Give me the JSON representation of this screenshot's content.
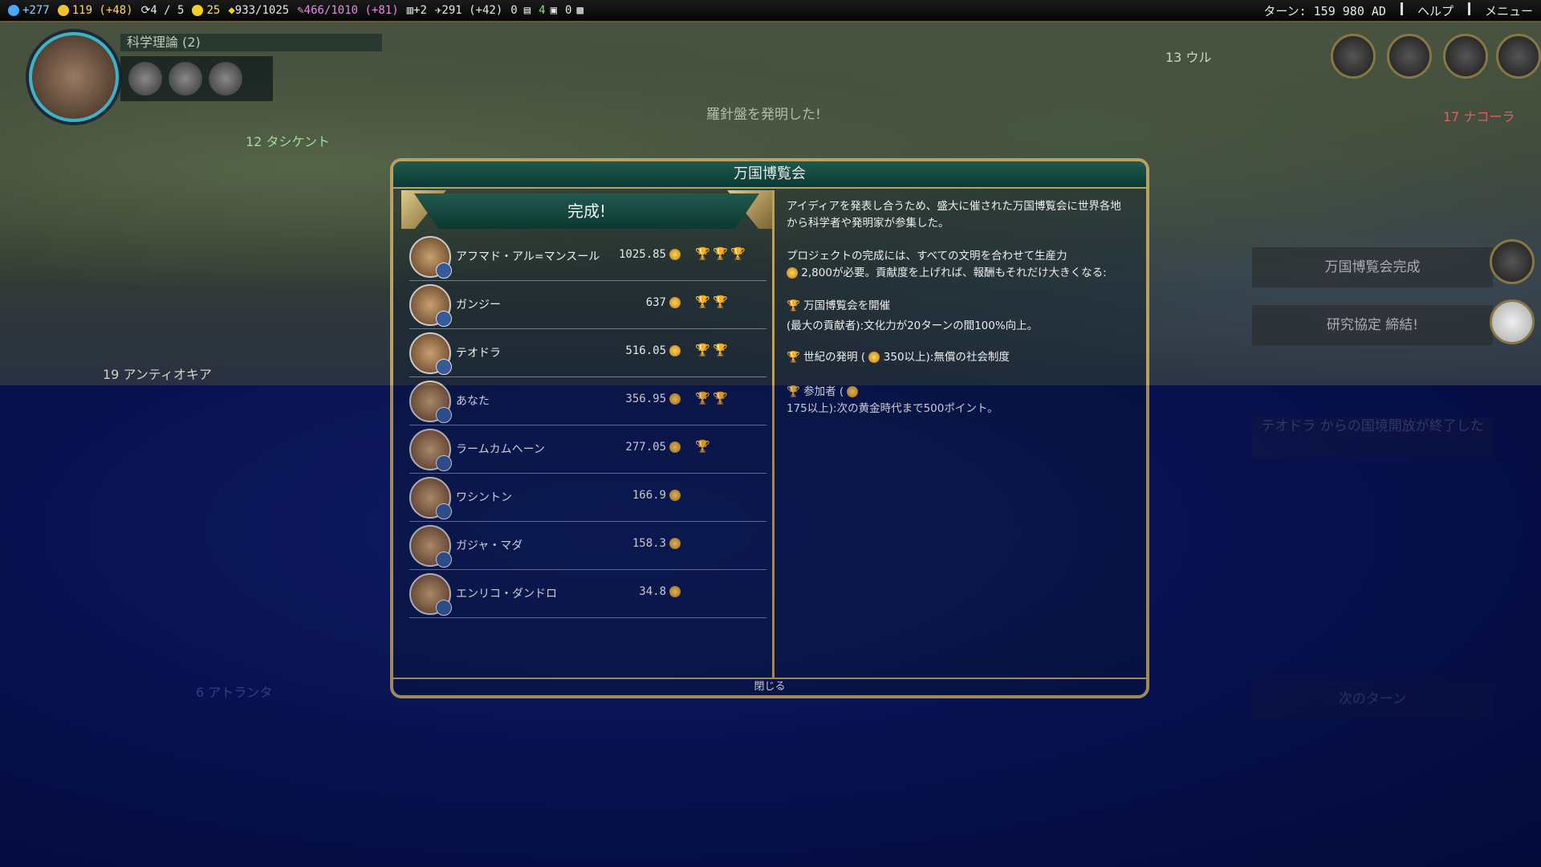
{
  "topbar": {
    "science": "+277",
    "gold": "119 (+48)",
    "trade_routes": "4 / 5",
    "happiness": "25",
    "golden_age": "933/1025",
    "culture": "466/1010 (+81)",
    "tourism": "+2",
    "faith": "291 (+42)",
    "count_a": "0",
    "count_b": "4",
    "count_c": "0",
    "turn": "ターン: 159 980 AD",
    "help": "ヘルプ",
    "menu": "メニュー"
  },
  "map": {
    "research_label": "科学理論 (2)",
    "toast": "羅針盤を発明した!",
    "city_antioch": "19 アンティオキア",
    "city_tash": "12 タシケント",
    "city_ur": "13 ウル",
    "city_17": "17 ナコーラ",
    "city_atl": "6 アトランタ",
    "notif_fair": "万国博覧会完成",
    "notif_research": "研究協定 締結!",
    "notif_open_borders": "テオドラ からの国境開放が終了した",
    "next_turn": "次のターン"
  },
  "dialog": {
    "title": "万国博覧会",
    "banner": "完成!",
    "close": "閉じる",
    "rows": [
      {
        "name": "アフマド・アル=マンスール",
        "value": "1025.85",
        "trophies": [
          "bronze",
          "silver",
          "gold"
        ]
      },
      {
        "name": "ガンジー",
        "value": "637",
        "trophies": [
          "bronze",
          "silver"
        ]
      },
      {
        "name": "テオドラ",
        "value": "516.05",
        "trophies": [
          "bronze",
          "silver"
        ]
      },
      {
        "name": "あなた",
        "value": "356.95",
        "trophies": [
          "bronze",
          "silver"
        ]
      },
      {
        "name": "ラームカムヘーン",
        "value": "277.05",
        "trophies": [
          "bronze"
        ]
      },
      {
        "name": "ワシントン",
        "value": "166.9",
        "trophies": []
      },
      {
        "name": "ガジャ・マダ",
        "value": "158.3",
        "trophies": []
      },
      {
        "name": "エンリコ・ダンドロ",
        "value": "34.8",
        "trophies": []
      }
    ],
    "desc1": "アイディアを発表し合うため、盛大に催された万国博覧会に世界各地から科学者や発明家が参集した。",
    "desc2a": "プロジェクトの完成には、すべての文明を合わせて生産力",
    "desc2b": "2,800が必要。貢献度を上げれば、報酬もそれだけ大きくなる:",
    "reward1_title": "万国博覧会を開催",
    "reward1_body": "(最大の貢献者):文化力が20ターンの間100%向上。",
    "reward2_title": "世紀の発明",
    "reward2_body": "350以上):無償の社会制度",
    "reward3_title": "参加者",
    "reward3_body": "175以上):次の黄金時代まで500ポイント。"
  }
}
